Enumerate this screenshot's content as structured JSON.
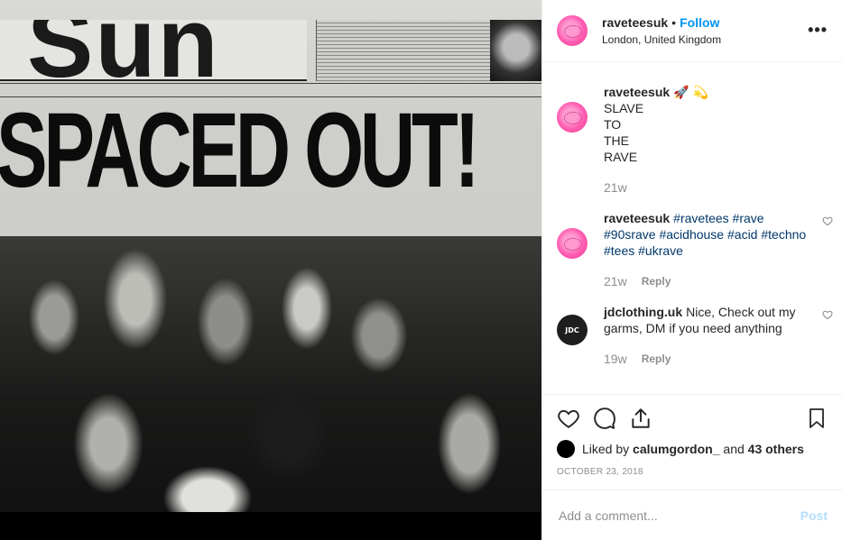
{
  "post": {
    "username": "raveteesuk",
    "separator": "•",
    "follow_label": "Follow",
    "location": "London, United Kingdom",
    "more_label": "•••"
  },
  "image": {
    "masthead": "Sun",
    "headline": "SPACED OUT!"
  },
  "comments": [
    {
      "username": "raveteesuk",
      "emoji": "🚀 💫",
      "lines": [
        "SLAVE",
        "TO",
        "THE",
        "RAVE"
      ],
      "time": "21w"
    },
    {
      "username": "raveteesuk",
      "hashtags": [
        "#ravetees",
        "#rave",
        "#90srave",
        "#acidhouse",
        "#acid",
        "#techno",
        "#tees",
        "#ukrave"
      ],
      "time": "21w",
      "reply_label": "Reply"
    },
    {
      "username": "jdclothing.uk",
      "avatar_text": "JDC",
      "text": "Nice, Check out my garms, DM if you need anything",
      "time": "19w",
      "reply_label": "Reply"
    }
  ],
  "likes": {
    "prefix": "Liked by",
    "user": "calumgordon_",
    "middle": "and",
    "others": "43 others"
  },
  "date": "OCTOBER 23, 2018",
  "add_comment": {
    "placeholder": "Add a comment...",
    "post_label": "Post"
  },
  "colors": {
    "accent": "#0095f6",
    "hashtag": "#00376b",
    "muted": "#8e8e8e",
    "post_disabled": "#b2dffc",
    "avatar_pink": "#ff5db1"
  },
  "icons": {
    "like": "heart-icon",
    "comment": "comment-icon",
    "share": "share-icon",
    "save": "bookmark-icon"
  }
}
